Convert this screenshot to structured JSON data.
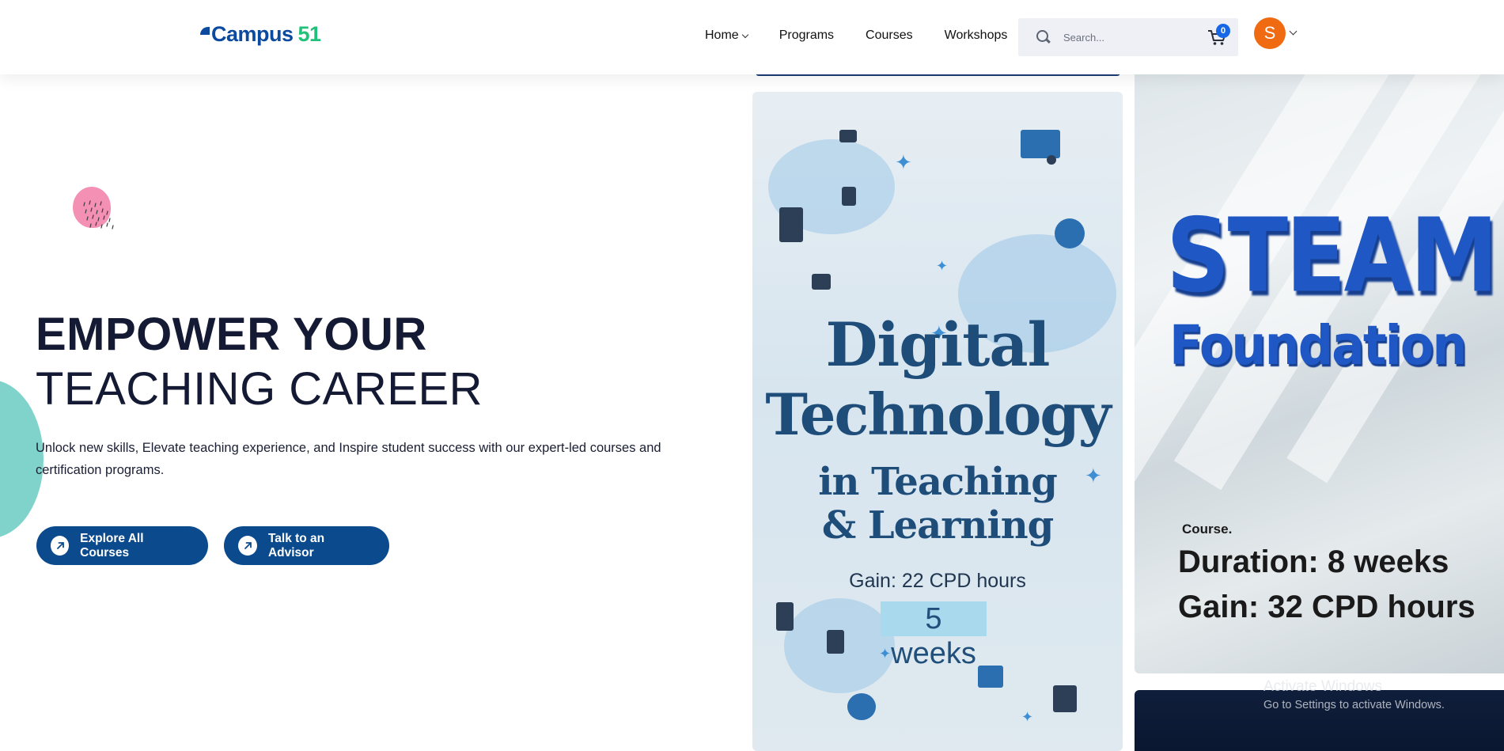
{
  "header": {
    "logo": {
      "campus": "Campus",
      "num": "51"
    },
    "nav": [
      {
        "label": "Home",
        "has_dropdown": true
      },
      {
        "label": "Programs"
      },
      {
        "label": "Courses"
      },
      {
        "label": "Workshops"
      }
    ],
    "search": {
      "placeholder": "Search..."
    },
    "cart": {
      "count": "0",
      "icon": "cart-icon"
    },
    "user": {
      "initial": "S",
      "color": "#ef6a10"
    }
  },
  "hero": {
    "title_line1": "EMPOWER YOUR",
    "title_line2": "TEACHING CAREER",
    "subtitle": "Unlock new skills, Elevate teaching experience, and Inspire student success with our expert-led courses and certification programs.",
    "buttons": [
      {
        "label": "Explore All Courses",
        "icon": "arrow-up-right-icon"
      },
      {
        "label": "Talk to an Advisor",
        "icon": "arrow-up-right-icon"
      }
    ]
  },
  "cards": {
    "digital": {
      "line1": "Digital",
      "line2": "Technology",
      "line3": "in Teaching",
      "line4": "& Learning",
      "gain": "Gain: 22 CPD hours",
      "weeks": "5 weeks"
    },
    "steam": {
      "line1": "STEAM",
      "line2": "Foundation",
      "label": "Course.",
      "duration": "Duration: 8 weeks",
      "gain": "Gain: 32 CPD hours"
    }
  },
  "watermark": {
    "line1": "Activate Windows",
    "line2": "Go to Settings to activate Windows."
  },
  "colors": {
    "brand": "#0b4a9e",
    "brand_accent": "#20c27a",
    "button": "#0b4a8c",
    "title": "#141a33"
  }
}
